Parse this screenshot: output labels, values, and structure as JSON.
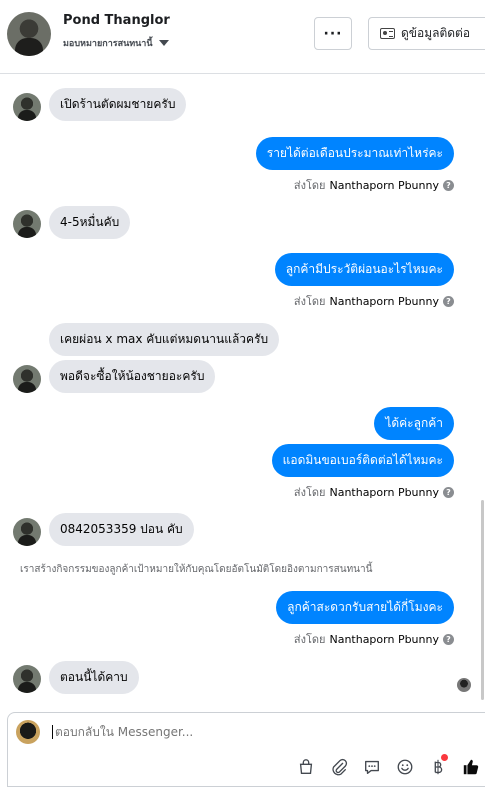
{
  "header": {
    "name": "Pond Thanglor",
    "subtitle": "มอบหมายการสนทนานี้",
    "more_label": "···",
    "contact_label": "ดูข้อมูลติดต่อ"
  },
  "messages": [
    {
      "dir": "in",
      "text": "เปิดร้านตัดผมชายครับ"
    },
    {
      "dir": "out",
      "text": "รายได้ต่อเดือนประมาณเท่าไหร่คะ"
    },
    {
      "dir": "in",
      "text": "4-5หมื่นคับ"
    },
    {
      "dir": "out",
      "text": "ลูกค้ามีประวัติผ่อนอะไรไหมคะ"
    },
    {
      "dir": "in",
      "text": "เคยผ่อน x max คับแต่หมดนานแล้วครับ"
    },
    {
      "dir": "in",
      "text": "พอดีจะซื้อให้น้องชายอะครับ"
    },
    {
      "dir": "out",
      "text": "ได้ค่ะลูกค้า"
    },
    {
      "dir": "out",
      "text": "แอดมินขอเบอร์ติดต่อได้ไหมคะ"
    },
    {
      "dir": "in",
      "text": "0842053359 ปอน คับ"
    },
    {
      "dir": "out",
      "text": "ลูกค้าสะดวกรับสายได้กี่โมงคะ"
    },
    {
      "dir": "in",
      "text": "ตอนนี้ได้คาบ"
    }
  ],
  "sent_by": {
    "prefix": "ส่งโดย",
    "name": "Nanthaporn Pbunny",
    "info": "?"
  },
  "system_note": "เราสร้างกิจกรรมของลูกค้าเป้าหมายให้กับคุณโดยอัตโนมัติโดยอิงตามการสนทนานี้",
  "composer": {
    "placeholder": "ตอบกลับใน Messenger...",
    "tools": [
      "bag-icon",
      "paperclip-icon",
      "saved-reply-icon",
      "emoji-icon",
      "baht-icon",
      "like-icon"
    ]
  },
  "colors": {
    "accent": "#0084ff",
    "incoming_bubble": "#e4e6eb",
    "like_icon": "#0a0a0a",
    "badge": "#fa383e"
  }
}
